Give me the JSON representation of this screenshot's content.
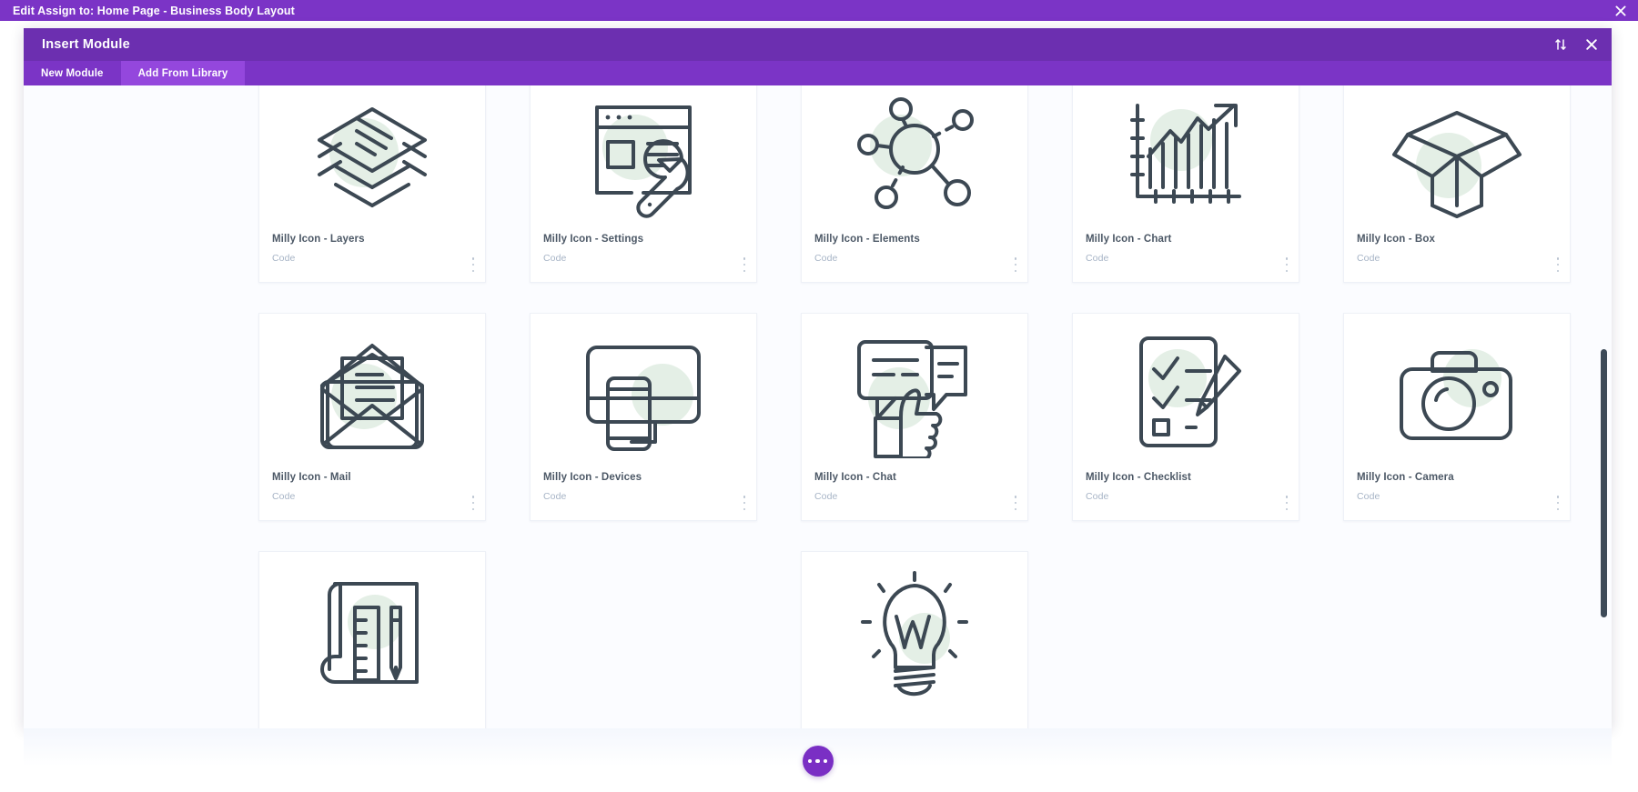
{
  "topbar": {
    "title": "Edit Assign to: Home Page - Business Body Layout",
    "close_icon": "close-icon"
  },
  "modal": {
    "title": "Insert Module",
    "sort_icon": "sort-arrows-icon",
    "close_icon": "close-icon",
    "tabs": [
      {
        "label": "New Module",
        "active": false
      },
      {
        "label": "Add From Library",
        "active": true
      }
    ]
  },
  "library": {
    "item_type_label": "Code",
    "kebab_icon": "more-vertical-icon",
    "items": [
      {
        "name": "Milly Icon - Layers",
        "type": "Code",
        "icon": "layers-icon"
      },
      {
        "name": "Milly Icon - Settings",
        "type": "Code",
        "icon": "settings-window-wrench-icon"
      },
      {
        "name": "Milly Icon - Elements",
        "type": "Code",
        "icon": "network-nodes-icon"
      },
      {
        "name": "Milly Icon - Chart",
        "type": "Code",
        "icon": "bar-chart-arrow-icon"
      },
      {
        "name": "Milly Icon - Box",
        "type": "Code",
        "icon": "open-box-icon"
      },
      {
        "name": "Milly Icon - Mail",
        "type": "Code",
        "icon": "open-envelope-icon"
      },
      {
        "name": "Milly Icon - Devices",
        "type": "Code",
        "icon": "monitor-phone-icon"
      },
      {
        "name": "Milly Icon - Chat",
        "type": "Code",
        "icon": "chat-bubbles-thumbsup-icon"
      },
      {
        "name": "Milly Icon - Checklist",
        "type": "Code",
        "icon": "clipboard-pencil-icon"
      },
      {
        "name": "Milly Icon - Camera",
        "type": "Code",
        "icon": "camera-icon"
      },
      {
        "name": "",
        "type": "",
        "icon": "blueprint-ruler-pencil-icon"
      },
      {
        "name": "",
        "type": "",
        "icon": ""
      },
      {
        "name": "",
        "type": "",
        "icon": "lightbulb-icon"
      }
    ]
  },
  "footer": {
    "fab_icon": "more-horizontal-icon"
  },
  "colors": {
    "admin_bar_purple": "#7b34c6",
    "modal_header_purple": "#6c2fb0",
    "tab_active_purple": "#9447dd",
    "icon_stroke": "#3c4853",
    "icon_mint": "#e4efe6",
    "card_title": "#4c5866",
    "card_type": "#a7b4c6",
    "scrollbar_thumb": "#3d4a58"
  }
}
